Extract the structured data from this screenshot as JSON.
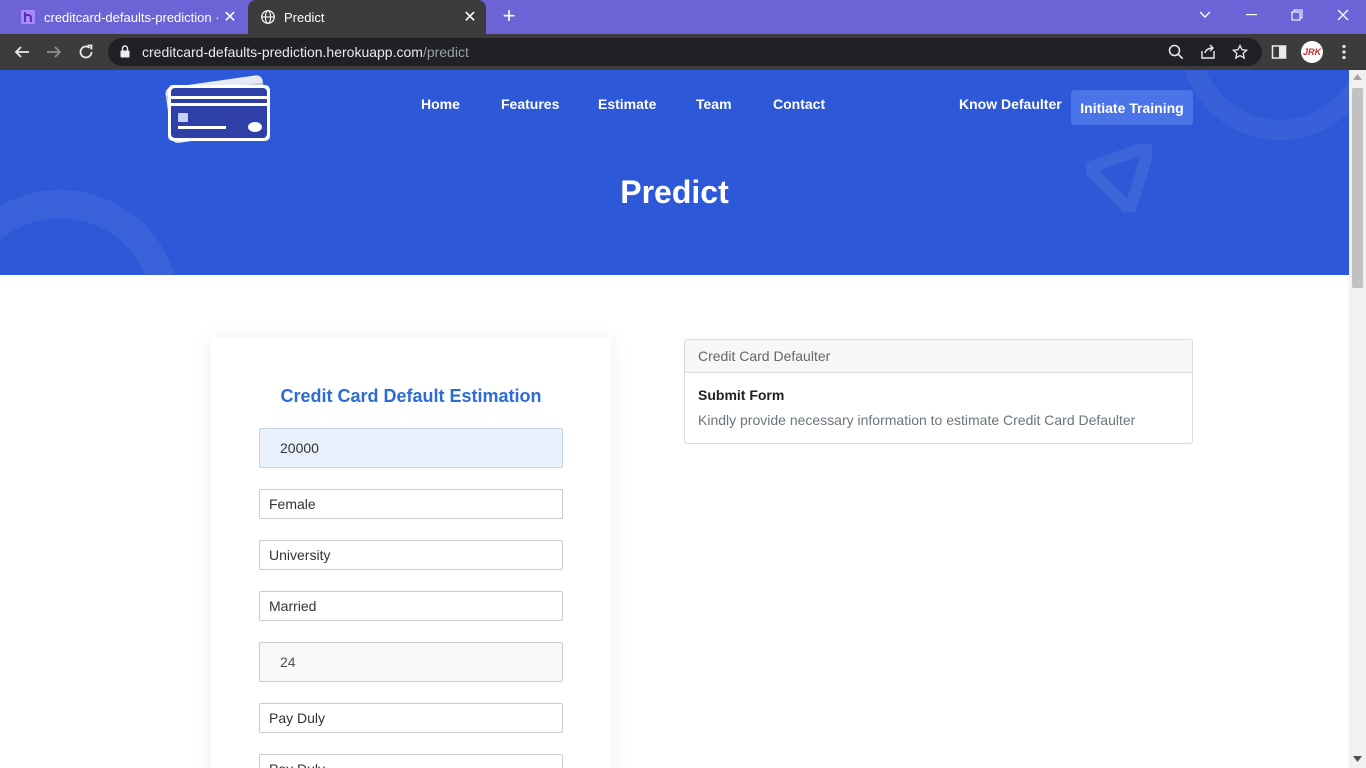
{
  "browser": {
    "tabs": [
      {
        "title": "creditcard-defaults-prediction · L",
        "active": false,
        "icon": "heroku-icon"
      },
      {
        "title": "Predict",
        "active": true,
        "icon": "globe-icon"
      }
    ],
    "url_host": "creditcard-defaults-prediction.herokuapp.com",
    "url_path": "/predict",
    "avatar_text": "JRK"
  },
  "header": {
    "nav": [
      "Home",
      "Features",
      "Estimate",
      "Team",
      "Contact"
    ],
    "know_defaulter": "Know Defaulter",
    "initiate_training": "Initiate Training",
    "title": "Predict"
  },
  "form": {
    "title": "Credit Card Default Estimation",
    "limit_balance": "20000",
    "sex": "Female",
    "education": "University",
    "marriage": "Married",
    "age": "24",
    "pay_status_1": "Pay Duly",
    "pay_status_2": "Pay Duly"
  },
  "info": {
    "header": "Credit Card Defaulter",
    "title": "Submit Form",
    "text": "Kindly provide necessary information to estimate Credit Card Defaulter"
  },
  "colors": {
    "hero_bg": "#2d58d7",
    "accent": "#2d6bd6",
    "tabbar": "#6b63d6"
  }
}
